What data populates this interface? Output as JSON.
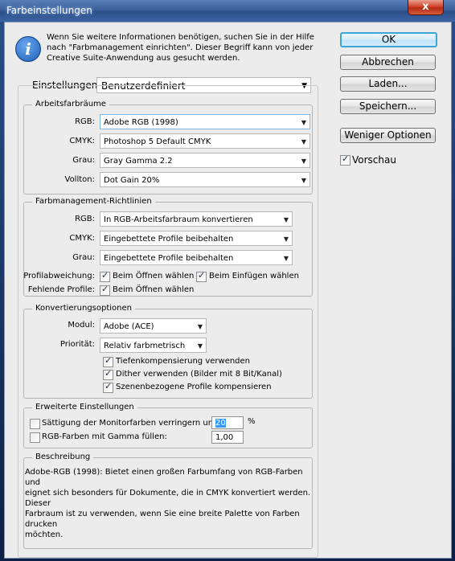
{
  "window": {
    "title": "Farbeinstellungen",
    "close_label": "x"
  },
  "intro": {
    "line1": "Wenn Sie weitere Informationen benötigen, suchen Sie in der Hilfe",
    "line2": "nach \"Farbmanagement einrichten\". Dieser Begriff kann von jeder",
    "line3": "Creative Suite-Anwendung aus gesucht werden."
  },
  "settings": {
    "label": "Einstellungen:",
    "value": "Benutzerdefiniert"
  },
  "buttons": {
    "ok": "OK",
    "cancel": "Abbrechen",
    "load": "Laden...",
    "save": "Speichern...",
    "fewer": "Weniger Optionen"
  },
  "preview": {
    "label": "Vorschau",
    "checked": true
  },
  "workspaces": {
    "title": "Arbeitsfarbräume",
    "rgb_label": "RGB:",
    "rgb_value": "Adobe RGB (1998)",
    "cmyk_label": "CMYK:",
    "cmyk_value": "Photoshop 5 Default CMYK",
    "gray_label": "Grau:",
    "gray_value": "Gray Gamma 2.2",
    "spot_label": "Vollton:",
    "spot_value": "Dot Gain 20%"
  },
  "policies": {
    "title": "Farbmanagement-Richtlinien",
    "rgb_label": "RGB:",
    "rgb_value": "In RGB-Arbeitsfarbraum konvertieren",
    "cmyk_label": "CMYK:",
    "cmyk_value": "Eingebettete Profile beibehalten",
    "gray_label": "Grau:",
    "gray_value": "Eingebettete Profile beibehalten",
    "mismatch_label": "Profilabweichung:",
    "mismatch_open": "Beim Öffnen wählen",
    "mismatch_paste": "Beim Einfügen wählen",
    "missing_label": "Fehlende Profile:",
    "missing_open": "Beim Öffnen wählen"
  },
  "conversion": {
    "title": "Konvertierungsoptionen",
    "engine_label": "Modul:",
    "engine_value": "Adobe (ACE)",
    "intent_label": "Priorität:",
    "intent_value": "Relativ farbmetrisch",
    "bpc": "Tiefenkompensierung verwenden",
    "dither": "Dither verwenden (Bilder mit 8 Bit/Kanal)",
    "scene": "Szenenbezogene Profile kompensieren"
  },
  "advanced": {
    "title": "Erweiterte Einstellungen",
    "desaturate_label": "Sättigung der Monitorfarben verringern um:",
    "desaturate_value": "20",
    "desaturate_unit": "%",
    "blend_label": "RGB-Farben mit Gamma füllen:",
    "blend_value": "1,00"
  },
  "description": {
    "title": "Beschreibung",
    "line1": "Adobe-RGB (1998): Bietet einen großen Farbumfang von RGB-Farben und",
    "line2": "eignet sich besonders für Dokumente, die in CMYK konvertiert werden. Dieser",
    "line3": "Farbraum ist zu verwenden, wenn Sie eine breite Palette von Farben drucken",
    "line4": "möchten."
  }
}
